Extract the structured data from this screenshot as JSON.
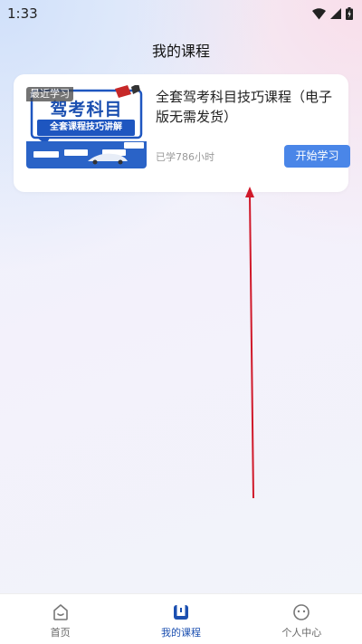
{
  "status_bar": {
    "time": "1:33"
  },
  "header": {
    "title": "我的课程"
  },
  "course": {
    "badge": "最近学习",
    "cover_title": "驾考科目",
    "cover_subtitle": "全套课程技巧讲解",
    "title": "全套驾考科目技巧课程（电子版无需发货）",
    "hours": "已学786小时",
    "start_label": "开始学习"
  },
  "bottom_nav": {
    "items": [
      {
        "label": "首页",
        "icon": "home-icon"
      },
      {
        "label": "我的课程",
        "icon": "book-icon",
        "active": true
      },
      {
        "label": "个人中心",
        "icon": "profile-icon"
      }
    ]
  },
  "colors": {
    "accent": "#4a86e8",
    "active_nav": "#1b4fb0",
    "annotation_arrow": "#d0192a"
  }
}
